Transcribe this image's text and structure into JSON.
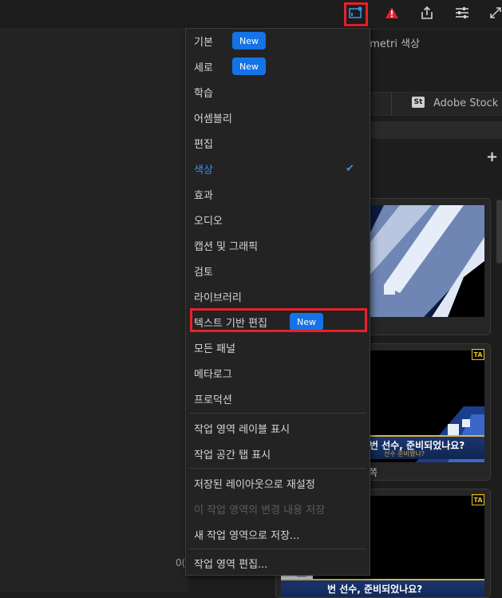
{
  "topbar": {
    "buttons": [
      {
        "name": "workspaces-icon"
      },
      {
        "name": "alert-icon"
      },
      {
        "name": "export-icon"
      },
      {
        "name": "panel-settings-icon"
      },
      {
        "name": "fullscreen-icon"
      }
    ]
  },
  "panel": {
    "title_fragment": "umetri 색상",
    "stock_badge": "St",
    "stock_tab": "Adobe Stock",
    "left_fragment": "0("
  },
  "cards": [
    {
      "caption": ""
    },
    {
      "caption": "쪽",
      "subtitle": "번 선수, 준비되었나요?",
      "subtitle_small": "선수 준비됐나?"
    },
    {
      "caption": "",
      "subtitle": "번 선수, 준비되었나요?"
    }
  ],
  "menu": {
    "items": [
      {
        "label": "기본",
        "badge": "New"
      },
      {
        "label": "세로",
        "badge": "New"
      },
      {
        "label": "학습"
      },
      {
        "label": "어셈블리"
      },
      {
        "label": "편집"
      },
      {
        "label": "색상",
        "active": true
      },
      {
        "label": "효과"
      },
      {
        "label": "오디오"
      },
      {
        "label": "캡션 및 그래픽"
      },
      {
        "label": "검토"
      },
      {
        "label": "라이브러리"
      },
      {
        "label": "텍스트 기반 편집",
        "badge": "New"
      },
      {
        "label": "모든 패널"
      },
      {
        "label": "메타로그"
      },
      {
        "label": "프로덕션"
      }
    ],
    "group2": [
      {
        "label": "작업 영역 레이블 표시"
      },
      {
        "label": "작업 공간 탭 표시"
      }
    ],
    "group3": [
      {
        "label": "저장된 레이아웃으로 재설정"
      },
      {
        "label": "이 작업 영역의 변경 내용 저장",
        "disabled": true
      },
      {
        "label": "새 작업 영역으로 저장..."
      }
    ],
    "group4": [
      {
        "label": "작업 영역 편집..."
      }
    ]
  },
  "colors": {
    "accent": "#1473e6",
    "highlight": "#e8202a",
    "active": "#3b8eea"
  }
}
